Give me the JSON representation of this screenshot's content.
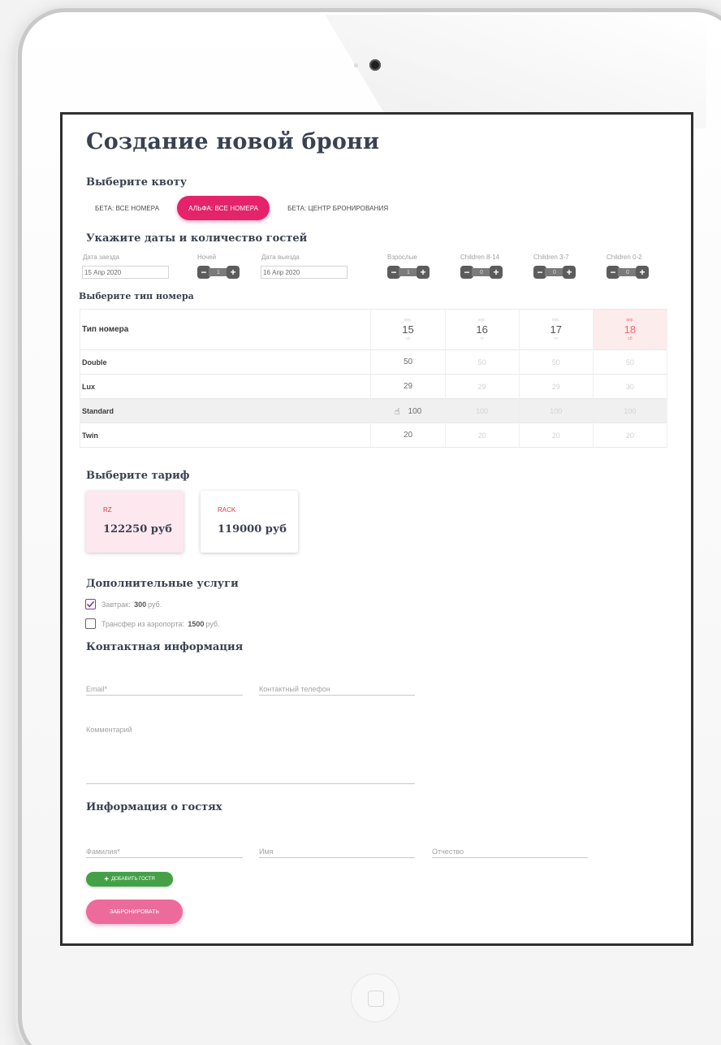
{
  "title": "Создание новой брони",
  "quota": {
    "heading": "Выберите квоту",
    "tabs": [
      {
        "label": "БЕТА: ВСЕ НОМЕРА",
        "active": false
      },
      {
        "label": "АЛЬФА: ВСЕ НОМЕРА",
        "active": true
      },
      {
        "label": "БЕТА: ЦЕНТР БРОНИРОВАНИЯ",
        "active": false
      }
    ]
  },
  "dates": {
    "heading": "Укажите даты и количество гостей",
    "checkin_label": "Дата заезда",
    "checkin_value": "15 Апр 2020",
    "nights_label": "Ночей",
    "nights_value": "1",
    "checkout_label": "Дата выезда",
    "checkout_value": "16 Апр 2020",
    "guests": [
      {
        "label": "Взрослые",
        "value": "1"
      },
      {
        "label": "Children 8-14",
        "value": "0"
      },
      {
        "label": "Children 3-7",
        "value": "0"
      },
      {
        "label": "Children 0-2",
        "value": "0"
      }
    ]
  },
  "rooms": {
    "heading": "Выберите тип номера",
    "col_header": "Тип номера",
    "days": [
      {
        "month": "апр.",
        "day": "15",
        "weekday": "ср",
        "weekend": false
      },
      {
        "month": "апр.",
        "day": "16",
        "weekday": "чт",
        "weekend": false
      },
      {
        "month": "апр.",
        "day": "17",
        "weekday": "пт",
        "weekend": false
      },
      {
        "month": "апр.",
        "day": "18",
        "weekday": "сб",
        "weekend": true
      }
    ],
    "rows": [
      {
        "name": "Double",
        "values": [
          "50",
          "50",
          "50",
          "50"
        ]
      },
      {
        "name": "Lux",
        "values": [
          "29",
          "29",
          "29",
          "30"
        ]
      },
      {
        "name": "Standard",
        "values": [
          "100",
          "100",
          "100",
          "100"
        ]
      },
      {
        "name": "Twin",
        "values": [
          "20",
          "20",
          "20",
          "20"
        ]
      }
    ]
  },
  "tariff": {
    "heading": "Выберите тариф",
    "items": [
      {
        "code": "RZ",
        "price": "122250 руб",
        "active": true
      },
      {
        "code": "RACK",
        "price": "119000 руб",
        "active": false
      }
    ]
  },
  "services": {
    "heading": "Дополнительные услуги",
    "items": [
      {
        "label": "Завтрак:",
        "price": "300",
        "unit": "руб.",
        "checked": true
      },
      {
        "label": "Трансфер из аэропорта:",
        "price": "1500",
        "unit": "руб.",
        "checked": false
      }
    ]
  },
  "contact": {
    "heading": "Контактная информация",
    "email_placeholder": "Email*",
    "phone_placeholder": "Контактный телефон",
    "comment_placeholder": "Комментарий"
  },
  "guests": {
    "heading": "Информация о гостях",
    "lastname_placeholder": "Фамилия*",
    "firstname_placeholder": "Имя",
    "patronymic_placeholder": "Отчество",
    "add_label": "Добавить гостя"
  },
  "book_label": "Забронировать",
  "colors": {
    "accent": "#e4236a",
    "book_button": "#ec6b9b",
    "add_button": "#43a047",
    "weekend": "#f06b6b",
    "tariff_code": "#e53935"
  }
}
